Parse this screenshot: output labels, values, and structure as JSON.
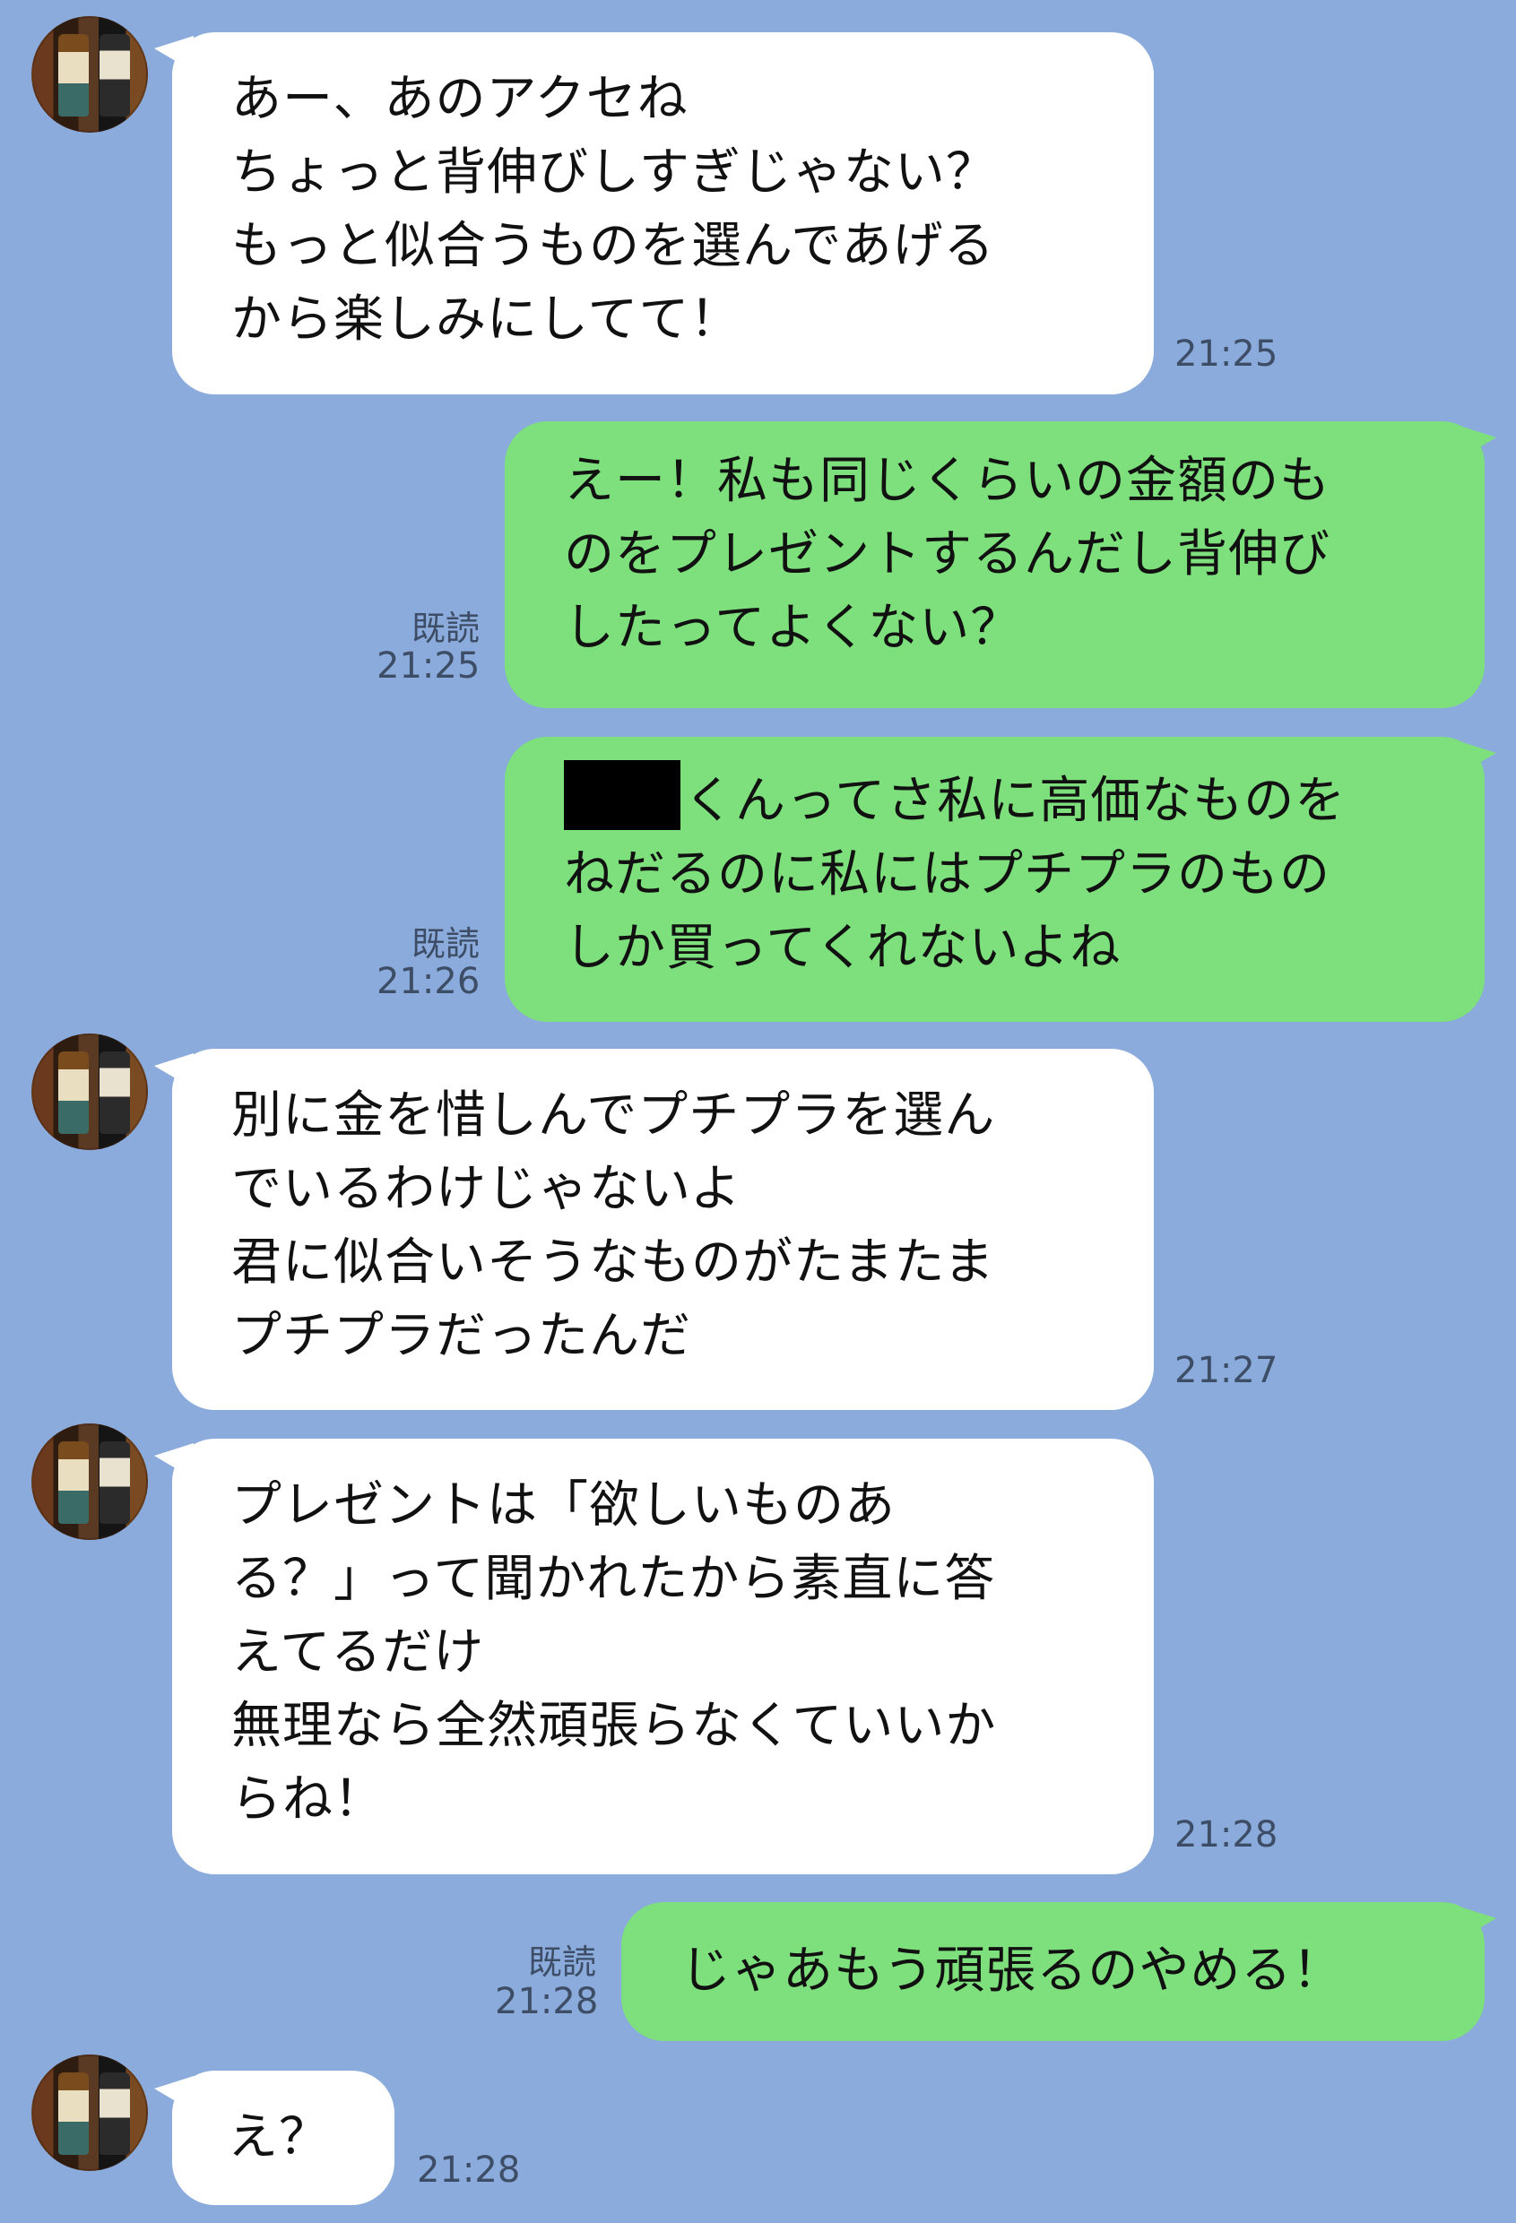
{
  "chat": {
    "messages": [
      {
        "side": "in",
        "text": "あー、あのアクセね\nちょっと背伸びしすぎじゃない？\nもっと似合うものを選んであげる\nから楽しみにしてて！",
        "time": "21:25"
      },
      {
        "side": "out",
        "text": "えー！私も同じくらいの金額のも\nのをプレゼントするんだし背伸び\nしたってよくない？",
        "read": "既読",
        "time": "21:25"
      },
      {
        "side": "out",
        "redacted_name": true,
        "text": "くんってさ私に高価なものを\nねだるのに私にはプチプラのもの\nしか買ってくれないよね",
        "read": "既読",
        "time": "21:26"
      },
      {
        "side": "in",
        "text": "別に金を惜しんでプチプラを選ん\nでいるわけじゃないよ\n君に似合いそうなものがたまたま\nプチプラだったんだ",
        "time": "21:27"
      },
      {
        "side": "in",
        "text": "プレゼントは「欲しいものあ\nる？」って聞かれたから素直に答\nえてるだけ\n無理なら全然頑張らなくていいか\nらね！",
        "time": "21:28"
      },
      {
        "side": "out",
        "text": "じゃあもう頑張るのやめる！",
        "read": "既読",
        "time": "21:28"
      },
      {
        "side": "in",
        "text": "え？",
        "time": "21:28"
      }
    ]
  },
  "colors": {
    "background": "#8aabdb",
    "incoming_bubble": "#ffffff",
    "outgoing_bubble": "#7de07c",
    "meta_text": "#3d4d66"
  },
  "icons": {
    "avatar": "bottles-photo-avatar"
  }
}
